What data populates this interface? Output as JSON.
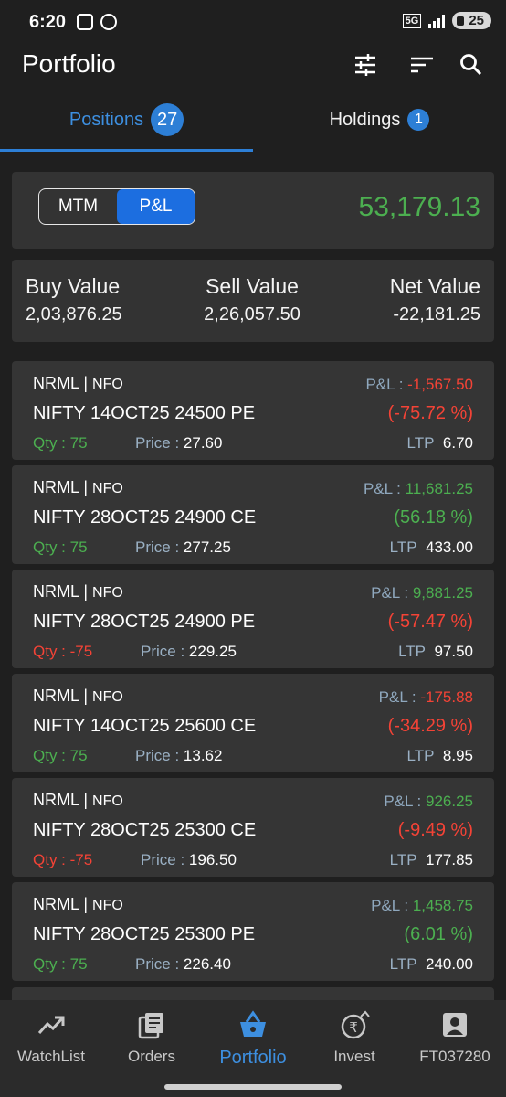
{
  "status_bar": {
    "time": "6:20",
    "network": "5G",
    "battery": "25"
  },
  "header": {
    "title": "Portfolio",
    "icons": [
      "filter-sliders-icon",
      "sort-icon",
      "search-icon"
    ]
  },
  "tabs": [
    {
      "label": "Positions",
      "count": "27",
      "active": true
    },
    {
      "label": "Holdings",
      "count": "1",
      "active": false
    }
  ],
  "pnl_toggle": {
    "options": [
      "MTM",
      "P&L"
    ],
    "selected": "P&L",
    "value": "53,179.13"
  },
  "summary": {
    "buy_label": "Buy Value",
    "buy_value": "2,03,876.25",
    "sell_label": "Sell Value",
    "sell_value": "2,26,057.50",
    "net_label": "Net Value",
    "net_value": "-22,181.25"
  },
  "labels": {
    "pnl": "P&L :",
    "qty": "Qty :",
    "price": "Price :",
    "ltp": "LTP"
  },
  "positions": [
    {
      "product": "NRML",
      "exchange": "NFO",
      "symbol": "NIFTY 14OCT25 24500 PE",
      "pnl": "-1,567.50",
      "pct": "(-75.72 %)",
      "qty": "75",
      "price": "27.60",
      "ltp": "6.70",
      "pnl_color": "red",
      "pct_color": "red",
      "qty_color": "green"
    },
    {
      "product": "NRML",
      "exchange": "NFO",
      "symbol": "NIFTY 28OCT25 24900 CE",
      "pnl": "11,681.25",
      "pct": "(56.18 %)",
      "qty": "75",
      "price": "277.25",
      "ltp": "433.00",
      "pnl_color": "green",
      "pct_color": "green",
      "qty_color": "green"
    },
    {
      "product": "NRML",
      "exchange": "NFO",
      "symbol": "NIFTY 28OCT25 24900 PE",
      "pnl": "9,881.25",
      "pct": "(-57.47 %)",
      "qty": "-75",
      "price": "229.25",
      "ltp": "97.50",
      "pnl_color": "green",
      "pct_color": "red",
      "qty_color": "red"
    },
    {
      "product": "NRML",
      "exchange": "NFO",
      "symbol": "NIFTY 14OCT25 25600 CE",
      "pnl": "-175.88",
      "pct": "(-34.29 %)",
      "qty": "75",
      "price": "13.62",
      "ltp": "8.95",
      "pnl_color": "red",
      "pct_color": "red",
      "qty_color": "green"
    },
    {
      "product": "NRML",
      "exchange": "NFO",
      "symbol": "NIFTY 28OCT25 25300 CE",
      "pnl": "926.25",
      "pct": "(-9.49 %)",
      "qty": "-75",
      "price": "196.50",
      "ltp": "177.85",
      "pnl_color": "green",
      "pct_color": "red",
      "qty_color": "red"
    },
    {
      "product": "NRML",
      "exchange": "NFO",
      "symbol": "NIFTY 28OCT25 25300 PE",
      "pnl": "1,458.75",
      "pct": "(6.01 %)",
      "qty": "75",
      "price": "226.40",
      "ltp": "240.00",
      "pnl_color": "green",
      "pct_color": "green",
      "qty_color": "green"
    }
  ],
  "bottom_nav": [
    {
      "label": "WatchList",
      "icon": "trending-up-icon",
      "active": false
    },
    {
      "label": "Orders",
      "icon": "orders-list-icon",
      "active": false
    },
    {
      "label": "Portfolio",
      "icon": "basket-icon",
      "active": true
    },
    {
      "label": "Invest",
      "icon": "rupee-invest-icon",
      "active": false
    },
    {
      "label": "FT037280",
      "icon": "account-icon",
      "active": false
    }
  ],
  "colors": {
    "accent": "#2d7fd6",
    "profit": "#4caf50",
    "loss": "#f44336",
    "background": "#1f1f1f",
    "card": "#353535"
  }
}
